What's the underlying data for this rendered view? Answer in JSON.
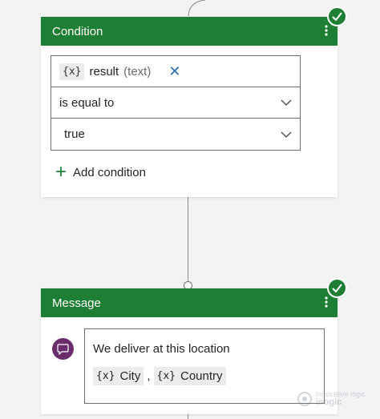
{
  "condition_node": {
    "title": "Condition",
    "variable": {
      "token": "{x}",
      "name": "result",
      "type": "(text)"
    },
    "operator": "is equal to",
    "value": "true",
    "add_condition_label": "Add condition"
  },
  "message_node": {
    "title": "Message",
    "text": "We deliver at this location",
    "variables": [
      {
        "token": "{x}",
        "name": "City"
      },
      {
        "token": "{x}",
        "name": "Country"
      }
    ],
    "separator": ","
  },
  "watermark": {
    "small": "innovative logic",
    "brand": "inogic"
  },
  "colors": {
    "header_green": "#1e7e34",
    "avatar_purple": "#6b2c6b",
    "close_blue": "#2b6cb0"
  }
}
